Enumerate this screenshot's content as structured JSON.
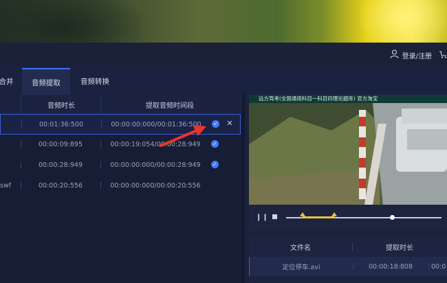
{
  "header": {
    "login_label": "登录/注册",
    "user_icon": "user-icon",
    "cart_icon": "cart-icon"
  },
  "tabs": [
    {
      "label": "合并",
      "active": false
    },
    {
      "label": "音频提取",
      "active": true
    },
    {
      "label": "音频转换",
      "active": false
    }
  ],
  "file_table": {
    "columns": [
      "音频时长",
      "提取音频时间段"
    ],
    "rows": [
      {
        "name": "",
        "duration": "00:01:36:500",
        "segment": "00:00:00:000/00:01:36:500",
        "checked": true,
        "selected": true
      },
      {
        "name": "",
        "duration": "00:00:09:895",
        "segment": "00:00:19:054/00:00:28:949",
        "checked": true,
        "selected": false
      },
      {
        "name": "",
        "duration": "00:00:28:949",
        "segment": "00:00:00:000/00:00:28:949",
        "checked": true,
        "selected": false
      },
      {
        "name": "swf",
        "duration": "00:00:20:556",
        "segment": "00:00:00:000/00:00:20:556",
        "checked": false,
        "selected": false
      }
    ]
  },
  "preview": {
    "caption": "远方驾考(全国通用科目一科目四理论题库)    官方淘宝",
    "progress": 0.7
  },
  "output_table": {
    "columns": [
      "文件名",
      "提取时长"
    ],
    "rows": [
      {
        "filename": "定位停车.avi",
        "duration": "00:00:18:808",
        "extra": "00:0"
      }
    ]
  },
  "colors": {
    "accent": "#3f6fff",
    "highlight": "#f0c23a",
    "annotation": "#e8352b"
  }
}
